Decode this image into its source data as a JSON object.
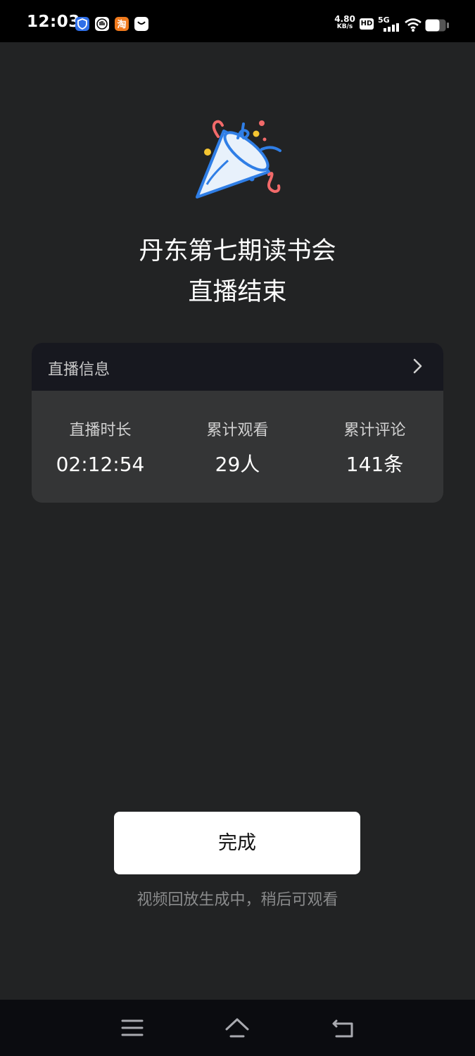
{
  "status_bar": {
    "time": "12:03",
    "net_speed_value": "4.80",
    "net_speed_unit": "KB/s",
    "hd_label": "HD",
    "signal_label": "5G",
    "notification_icons": [
      "shield-app-icon",
      "hand-app-icon",
      "taobao-app-icon",
      "message-app-icon"
    ]
  },
  "page": {
    "title_line1": "丹东第七期读书会",
    "title_line2": "直播结束"
  },
  "card": {
    "header_label": "直播信息",
    "stats": [
      {
        "label": "直播时长",
        "value": "02:12:54"
      },
      {
        "label": "累计观看",
        "value": "29人"
      },
      {
        "label": "累计评论",
        "value": "141条"
      }
    ]
  },
  "actions": {
    "done_label": "完成",
    "hint": "视频回放生成中，稍后可观看"
  },
  "colors": {
    "background": "#222324",
    "card": "#343536",
    "card_header": "#17181f",
    "button": "#ffffff"
  }
}
